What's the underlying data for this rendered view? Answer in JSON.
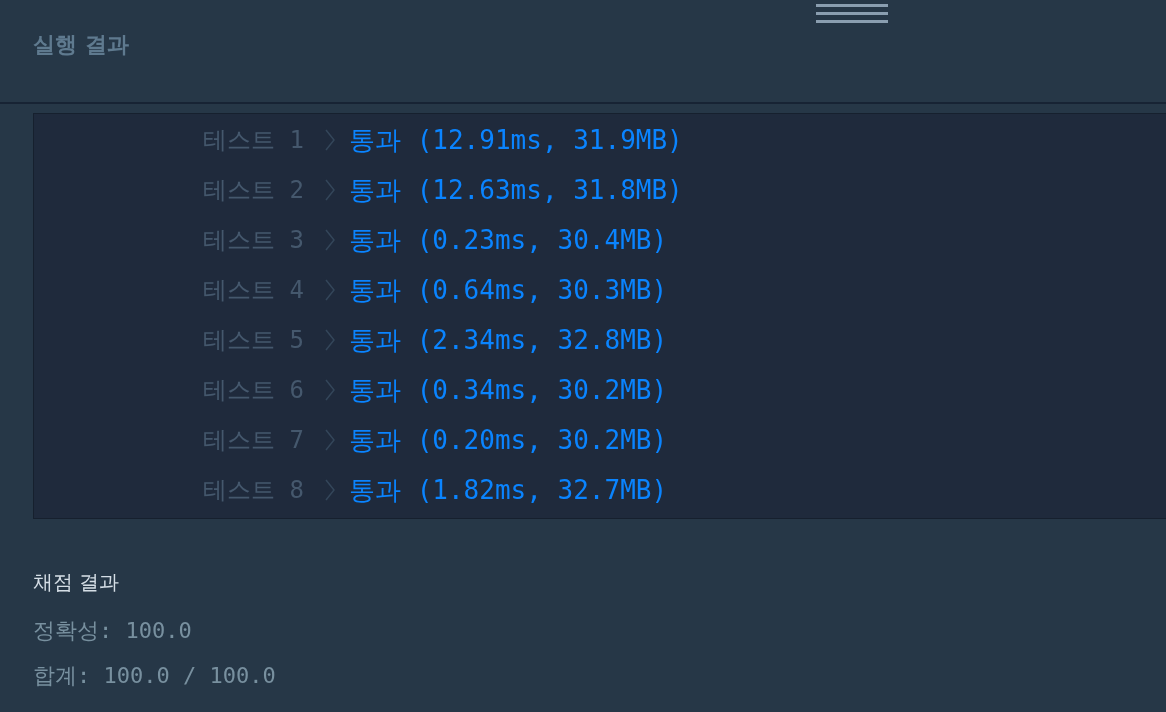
{
  "header": {
    "title": "실행 결과"
  },
  "tests": [
    {
      "label": "테스트 1",
      "passed": true,
      "result": "통과 (12.91ms, 31.9MB)"
    },
    {
      "label": "테스트 2",
      "passed": true,
      "result": "통과 (12.63ms, 31.8MB)"
    },
    {
      "label": "테스트 3",
      "passed": true,
      "result": "통과 (0.23ms, 30.4MB)"
    },
    {
      "label": "테스트 4",
      "passed": true,
      "result": "통과 (0.64ms, 30.3MB)"
    },
    {
      "label": "테스트 5",
      "passed": true,
      "result": "통과 (2.34ms, 32.8MB)"
    },
    {
      "label": "테스트 6",
      "passed": true,
      "result": "통과 (0.34ms, 30.2MB)"
    },
    {
      "label": "테스트 7",
      "passed": true,
      "result": "통과 (0.20ms, 30.2MB)"
    },
    {
      "label": "테스트 8",
      "passed": true,
      "result": "통과 (1.82ms, 32.7MB)"
    }
  ],
  "grading": {
    "title": "채점 결과",
    "lines": [
      "정확성: 100.0",
      "합계: 100.0 / 100.0"
    ]
  }
}
